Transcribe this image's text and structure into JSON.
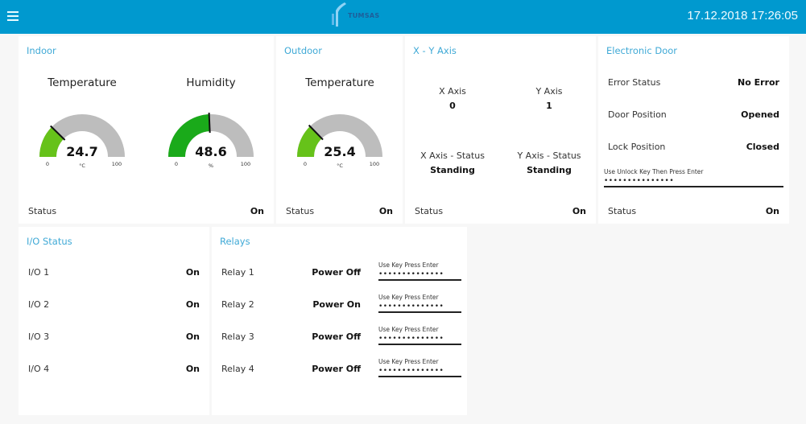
{
  "header": {
    "menu_icon": "hamburger-menu-icon",
    "logo_text": "TUMSAS",
    "datetime": "17.12.2018 17:26:05",
    "background_color": "#0099cf"
  },
  "indoor": {
    "title": "Indoor",
    "gauges": [
      {
        "title": "Temperature",
        "value": 24.7,
        "value_text": "24.7",
        "unit": "°C",
        "min": 0,
        "max": 100,
        "min_label": "0",
        "max_label": "100",
        "fill_color": "#66c21a"
      },
      {
        "title": "Humidity",
        "value": 48.6,
        "value_text": "48.6",
        "unit": "%",
        "min": 0,
        "max": 100,
        "min_label": "0",
        "max_label": "100",
        "fill_color": "#1aaa1a"
      }
    ],
    "status_label": "Status",
    "status_value": "On"
  },
  "outdoor": {
    "title": "Outdoor",
    "gauges": [
      {
        "title": "Temperature",
        "value": 25.4,
        "value_text": "25.4",
        "unit": "°C",
        "min": 0,
        "max": 100,
        "min_label": "0",
        "max_label": "100",
        "fill_color": "#66c21a"
      }
    ],
    "status_label": "Status",
    "status_value": "On"
  },
  "xy_axis": {
    "title": "X - Y Axis",
    "x_axis_label": "X Axis",
    "x_axis_value": "0",
    "y_axis_label": "Y Axis",
    "y_axis_value": "1",
    "x_status_label": "X Axis - Status",
    "x_status_value": "Standing",
    "y_status_label": "Y Axis - Status",
    "y_status_value": "Standing",
    "status_label": "Status",
    "status_value": "On"
  },
  "door": {
    "title": "Electronic Door",
    "rows": [
      {
        "label": "Error Status",
        "value": "No Error"
      },
      {
        "label": "Door Position",
        "value": "Opened"
      },
      {
        "label": "Lock Position",
        "value": "Closed"
      }
    ],
    "unlock_hint": "Use Unlock Key Then Press Enter",
    "unlock_value": "•••••••••••••••",
    "status_label": "Status",
    "status_value": "On"
  },
  "io_status": {
    "title": "I/O Status",
    "rows": [
      {
        "label": "I/O 1",
        "value": "On"
      },
      {
        "label": "I/O 2",
        "value": "On"
      },
      {
        "label": "I/O 3",
        "value": "On"
      },
      {
        "label": "I/O 4",
        "value": "On"
      }
    ]
  },
  "relays": {
    "title": "Relays",
    "rows": [
      {
        "label": "Relay 1",
        "value": "Power Off",
        "key_hint": "Use Key Press Enter",
        "key_value": "••••••••••••••"
      },
      {
        "label": "Relay 2",
        "value": "Power On",
        "key_hint": "Use Key Press Enter",
        "key_value": "••••••••••••••"
      },
      {
        "label": "Relay 3",
        "value": "Power Off",
        "key_hint": "Use Key Press Enter",
        "key_value": "••••••••••••••"
      },
      {
        "label": "Relay 4",
        "value": "Power Off",
        "key_hint": "Use Key Press Enter",
        "key_value": "••••••••••••••"
      }
    ]
  }
}
